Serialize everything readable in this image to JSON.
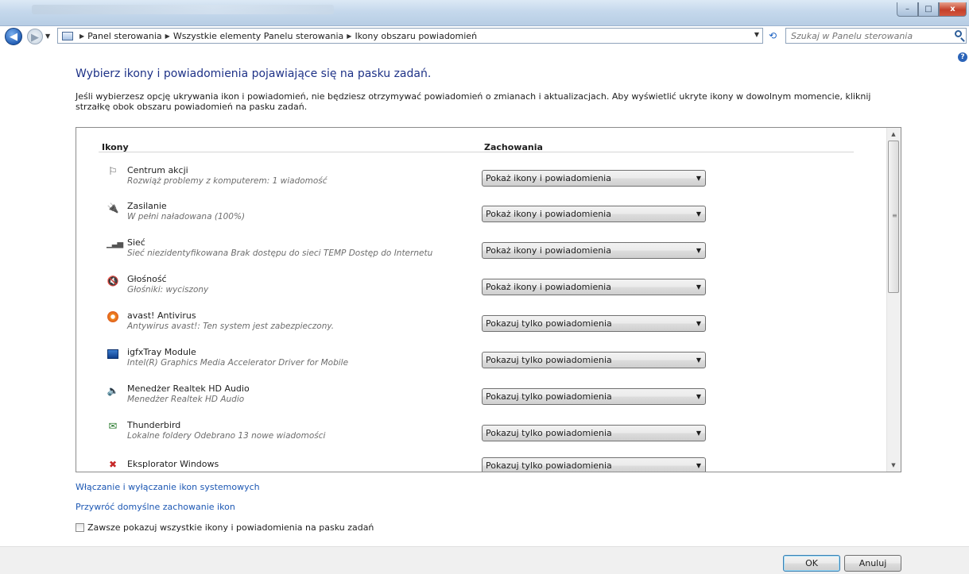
{
  "window": {
    "minimize_glyph": "–",
    "maximize_glyph": "□",
    "close_glyph": "x"
  },
  "navigation": {
    "breadcrumbs": [
      "Panel sterowania",
      "Wszystkie elementy Panelu sterowania",
      "Ikony obszaru powiadomień"
    ],
    "search_placeholder": "Szukaj w Panelu sterowania",
    "help_glyph": "?"
  },
  "main": {
    "heading": "Wybierz ikony i powiadomienia pojawiające się na pasku zadań.",
    "description": "Jeśli wybierzesz opcję ukrywania ikon i powiadomień, nie będziesz otrzymywać powiadomień o zmianach i aktualizacjach. Aby wyświetlić ukryte ikony w dowolnym momencie, kliknij strzałkę obok obszaru powiadomień na pasku zadań.",
    "columns": {
      "icons": "Ikony",
      "behaviors": "Zachowania"
    },
    "rows": [
      {
        "icon": "flag-icon",
        "name": "Centrum akcji",
        "desc": "Rozwiąż problemy z komputerem: 1 wiadomość",
        "behavior": "Pokaż ikony i powiadomienia"
      },
      {
        "icon": "power-icon",
        "name": "Zasilanie",
        "desc": "W pełni naładowana (100%)",
        "behavior": "Pokaż ikony i powiadomienia"
      },
      {
        "icon": "network-icon",
        "name": "Sieć",
        "desc": "Sieć niezidentyfikowana Brak dostępu do sieci TEMP Dostęp do Internetu",
        "behavior": "Pokaż ikony i powiadomienia"
      },
      {
        "icon": "volume-muted-icon",
        "name": "Głośność",
        "desc": "Głośniki: wyciszony",
        "behavior": "Pokaż ikony i powiadomienia"
      },
      {
        "icon": "avast-icon",
        "name": "avast! Antivirus",
        "desc": "Antywirus avast!: Ten system jest zabezpieczony.",
        "behavior": "Pokazuj tylko powiadomienia"
      },
      {
        "icon": "igfx-icon",
        "name": "igfxTray Module",
        "desc": "Intel(R) Graphics Media Accelerator Driver for Mobile",
        "behavior": "Pokazuj tylko powiadomienia"
      },
      {
        "icon": "speaker-icon",
        "name": "Menedżer Realtek HD Audio",
        "desc": "Menedżer Realtek HD Audio",
        "behavior": "Pokazuj tylko powiadomienia"
      },
      {
        "icon": "thunderbird-icon",
        "name": "Thunderbird",
        "desc": "Lokalne foldery Odebrano 13 nowe wiadomości",
        "behavior": "Pokazuj tylko powiadomienia"
      },
      {
        "icon": "explorer-icon",
        "name": "Eksplorator Windows",
        "desc": "",
        "behavior": "Pokazuj tylko powiadomienia"
      }
    ]
  },
  "links": {
    "system_icons": "Włączanie i wyłączanie ikon systemowych",
    "restore_defaults": "Przywróć domyślne zachowanie ikon"
  },
  "always_show": {
    "label": "Zawsze pokazuj wszystkie ikony i powiadomienia na pasku zadań",
    "checked": false
  },
  "footer": {
    "ok": "OK",
    "cancel": "Anuluj"
  }
}
